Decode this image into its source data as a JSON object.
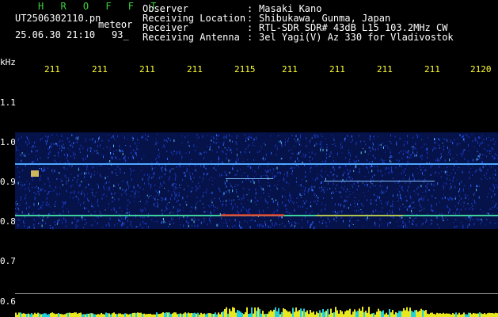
{
  "header": {
    "title": "H R O F F T",
    "filename": "UT2506302110.pn",
    "file_tag": "meteor",
    "timestamp": "25.06.30 21:10",
    "count": "93_"
  },
  "info": [
    {
      "key": "Observer",
      "sep": ":",
      "value": "Masaki Kano"
    },
    {
      "key": "Receiving Location",
      "sep": ":",
      "value": "Shibukawa, Gunma, Japan"
    },
    {
      "key": "Receiver",
      "sep": ":",
      "value": "RTL-SDR SDR# 43dB L15 103.2MHz CW"
    },
    {
      "key": "Receiving Antenna",
      "sep": ":",
      "value": "3el Yagi(V) Az 330 for Vladivostok"
    }
  ],
  "axis": {
    "unit": "kHz",
    "y_ticks": [
      "1.1",
      "1.0",
      "0.9",
      "0.8",
      "0.7",
      "0.6"
    ],
    "x_ticks": [
      "211",
      "211",
      "211",
      "211",
      "2115",
      "211",
      "211",
      "211",
      "211",
      "2120"
    ]
  },
  "colors": {
    "background": "#000000",
    "title": "#3ccf3c",
    "x_tick": "#ffff33",
    "noise": "#1a3cc8",
    "signal_line": "#4fa8ff",
    "hot": "#ff3020",
    "bottom_bars": "#e8e820",
    "bottom_cyan": "#20d0e0"
  }
}
